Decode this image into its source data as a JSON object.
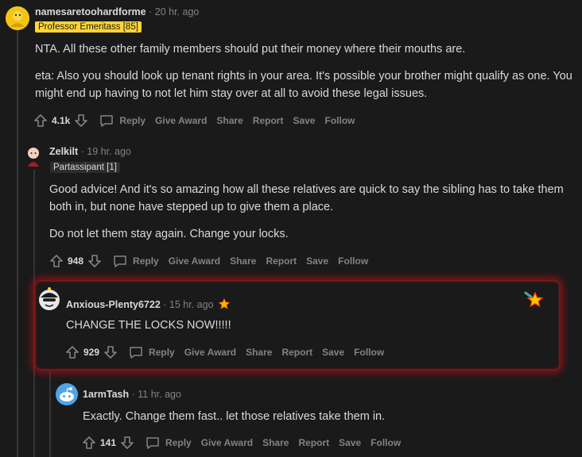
{
  "colors": {
    "background": "#1a1a1b",
    "text": "#d7dadc",
    "meta": "#818384",
    "highlight": "#b31414"
  },
  "comments": [
    {
      "author": "namesaretoohardforme",
      "time": "· 20 hr. ago",
      "flair": "Professor Emeritass [85]",
      "paragraphs": [
        "NTA. All these other family members should put their money where their mouths are.",
        "eta: Also you should look up tenant rights in your area. It's possible your brother might qualify as one. You might end up having to not let him stay over at all to avoid these legal issues."
      ],
      "score": "4.1k"
    },
    {
      "author": "Zelkilt",
      "time": "· 19 hr. ago",
      "flair": "Partassipant [1]",
      "paragraphs": [
        "Good advice! And it's so amazing how all these relatives are quick to say the sibling has to take them both in, but none have stepped up to give them a place.",
        "Do not let them stay again. Change your locks."
      ],
      "score": "948"
    },
    {
      "author": "Anxious-Plenty6722",
      "time": "· 15 hr. ago",
      "paragraphs": [
        "CHANGE THE LOCKS NOW!!!!!"
      ],
      "score": "929"
    },
    {
      "author": "1armTash",
      "time": "· 11 hr. ago",
      "paragraphs": [
        "Exactly. Change them fast.. let those relatives take them in."
      ],
      "score": "141"
    }
  ],
  "actions": {
    "reply": "Reply",
    "award": "Give Award",
    "share": "Share",
    "report": "Report",
    "save": "Save",
    "follow": "Follow"
  },
  "icons": [
    "upvote-icon",
    "downvote-icon",
    "reply-bubble-icon",
    "award-star-icon",
    "avatar-icon"
  ]
}
